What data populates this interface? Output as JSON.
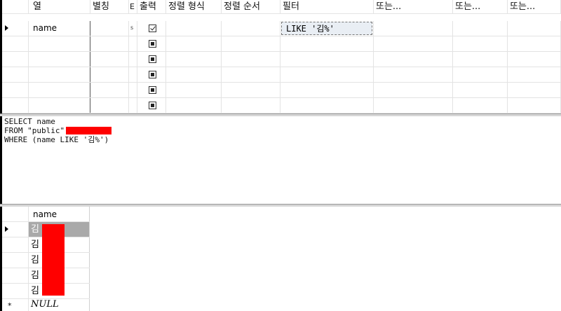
{
  "criteria": {
    "headers": [
      "열",
      "별칭",
      "E",
      "출력",
      "정렬 형식",
      "정렬 순서",
      "필터",
      "또는...",
      "또는...",
      "또는..."
    ],
    "row1": {
      "column": "name",
      "table_abbrev": "s",
      "output": "checked",
      "filter": "LIKE '김%'"
    }
  },
  "sql": {
    "line1": "SELECT name",
    "line2": "FROM \"public\".",
    "line3": "WHERE (name LIKE '김%')"
  },
  "results": {
    "header": "name",
    "rows": [
      "김",
      "김",
      "김",
      "김",
      "김"
    ],
    "new_row": "NULL",
    "new_row_marker": "*"
  },
  "colors": {
    "redaction": "#ff0000",
    "selected_row": "#a9a9a9",
    "filter_cell_bg": "#e9eef4"
  }
}
